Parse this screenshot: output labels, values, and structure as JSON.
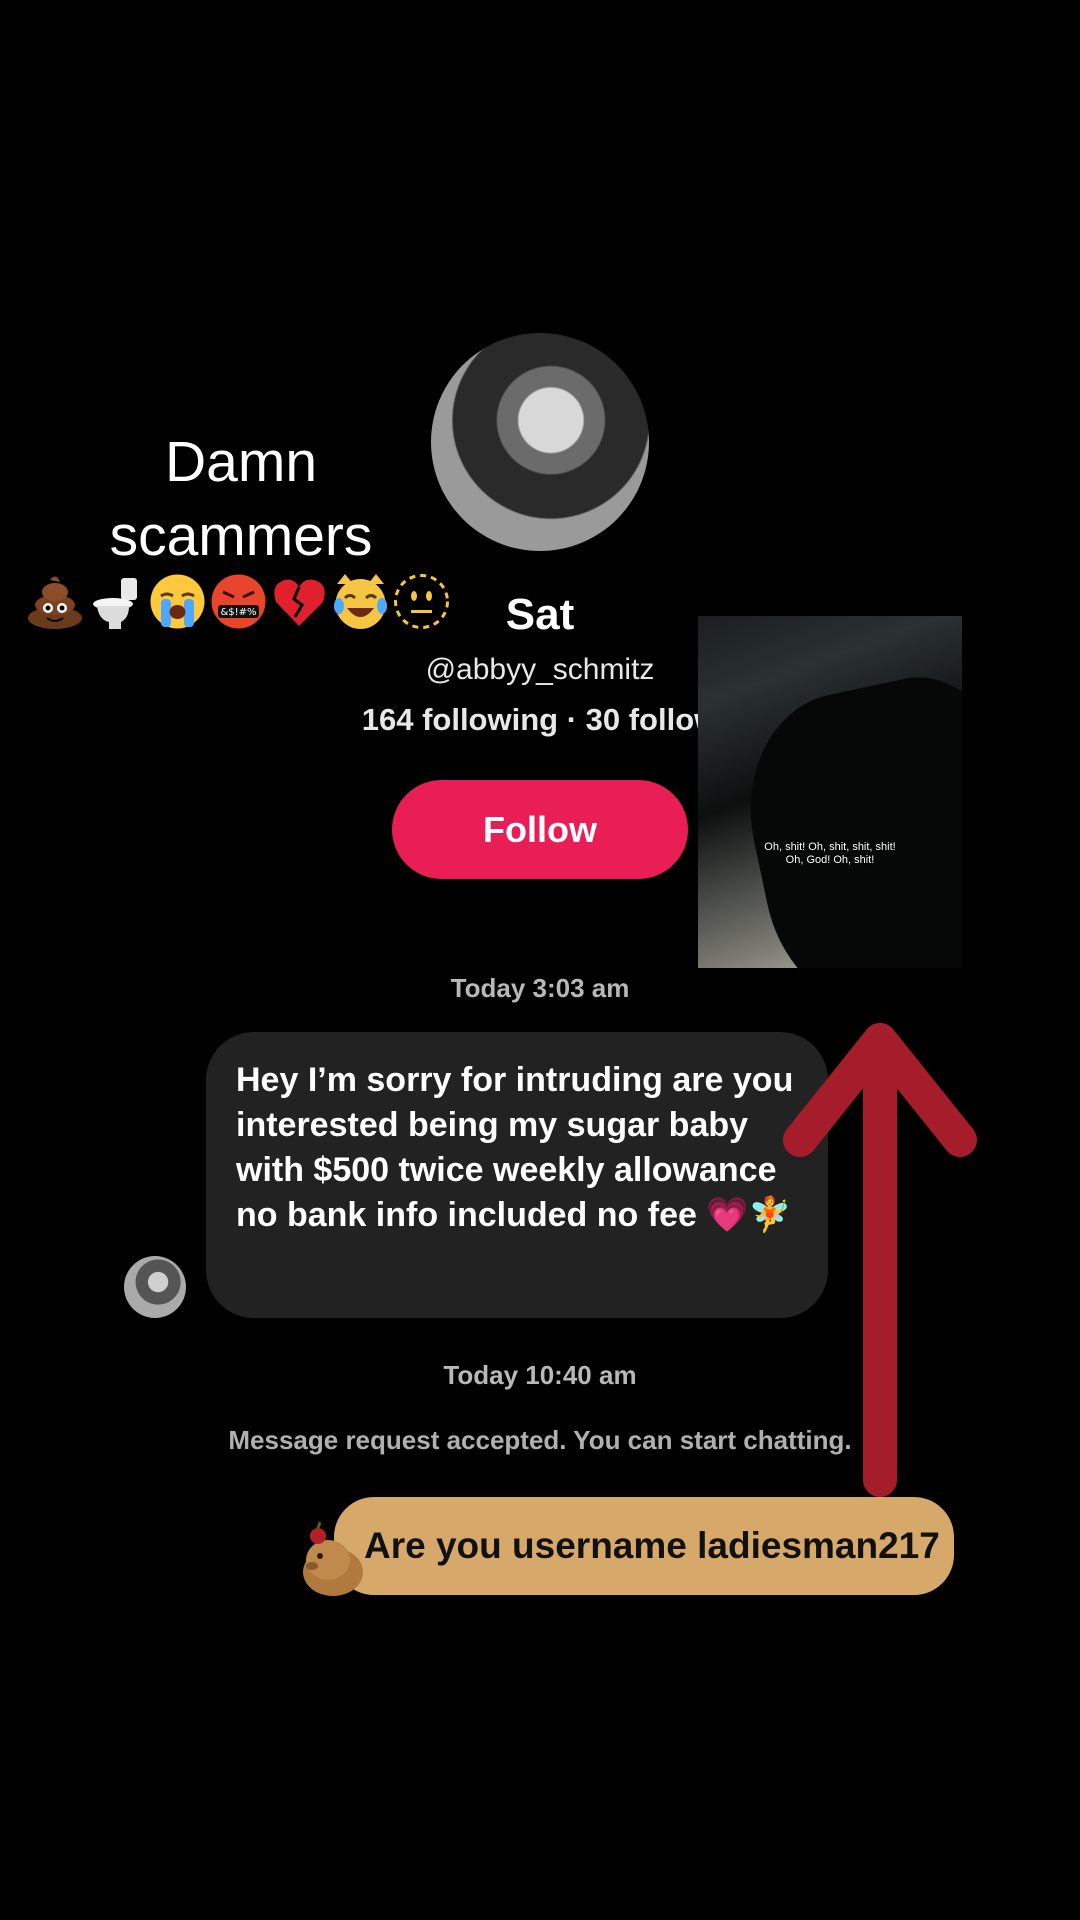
{
  "caption": {
    "text": "Damn scammers",
    "emojis": [
      "pile-of-poo-icon",
      "toilet-icon",
      "loudly-crying-face-icon",
      "cursing-face-icon",
      "broken-heart-icon",
      "cat-tears-of-joy-icon",
      "dotted-line-face-icon"
    ]
  },
  "profile": {
    "name": "Sat",
    "handle": "@abbyy_schmitz",
    "stats": "164 following · 30 follow",
    "follow_label": "Follow"
  },
  "chat": {
    "timestamp_1": "Today 3:03 am",
    "incoming_message": "Hey I’m sorry for intruding are you interested being my sugar baby with $500 twice weekly allowance no bank info included no fee",
    "message_emojis": "💗🧚",
    "timestamp_2": "Today 10:40 am",
    "system_message": "Message request accepted. You can start chatting.",
    "reply": "Are you username ladiesman217"
  },
  "video_overlay": {
    "subtitle_line1": "Oh, shit! Oh, shit, shit, shit!",
    "subtitle_line2": "Oh, God! Oh, shit!"
  },
  "colors": {
    "follow": "#ea1e56",
    "arrow": "#a51d2a",
    "reply_bubble": "#d6a96a",
    "incoming_bubble": "#222222"
  }
}
